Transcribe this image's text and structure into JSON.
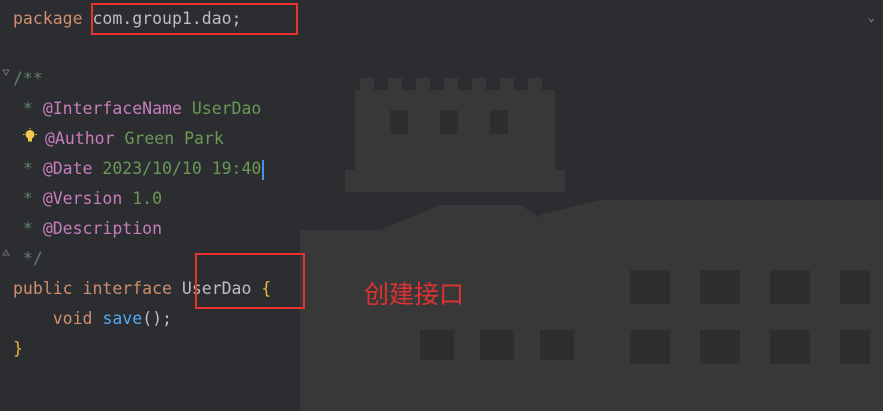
{
  "editor": {
    "package_keyword": "package",
    "package_name": "com.group1.dao;",
    "javadoc_open": "/**",
    "tags": [
      {
        "prefix": " * ",
        "tag": "@InterfaceName",
        "value": " UserDao"
      },
      {
        "prefix": "",
        "tag": "@Author",
        "value": " Green Park"
      },
      {
        "prefix": " * ",
        "tag": "@Date",
        "value": " 2023/10/10 19:40"
      },
      {
        "prefix": " * ",
        "tag": "@Version",
        "value": " 1.0"
      },
      {
        "prefix": " * ",
        "tag": "@Description",
        "value": ""
      }
    ],
    "javadoc_close": " */",
    "decl_keyword1": "public",
    "decl_keyword2": "interface",
    "interface_name": "UserDao",
    "open_brace": "{",
    "method_type": "void",
    "method_name": "save",
    "method_parens": "();",
    "close_brace": "}"
  },
  "annotation": {
    "label": "创建接口",
    "color": "#e03232"
  },
  "icons": {
    "intention": "lightbulb-icon",
    "fold": "fold-marker-icon",
    "scroll_hint": "chevron-down-icon"
  }
}
